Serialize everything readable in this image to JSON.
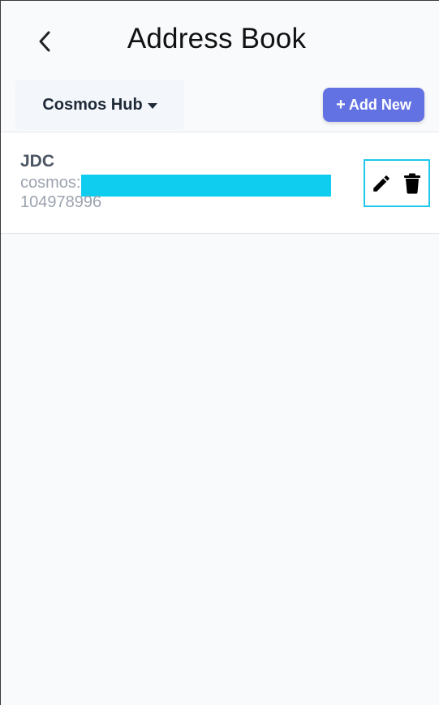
{
  "header": {
    "title": "Address Book",
    "back_icon": "chevron-left-icon"
  },
  "toolbar": {
    "network_label": "Cosmos Hub",
    "add_new_label": "Add New",
    "add_new_prefix": "+",
    "accent_color": "#6372e3"
  },
  "entries": [
    {
      "name": "JDC",
      "address_prefix": "cosmos:",
      "address_suffix": "104978996",
      "address_redacted": true,
      "actions": [
        "pencil-icon",
        "trash-icon"
      ]
    }
  ]
}
